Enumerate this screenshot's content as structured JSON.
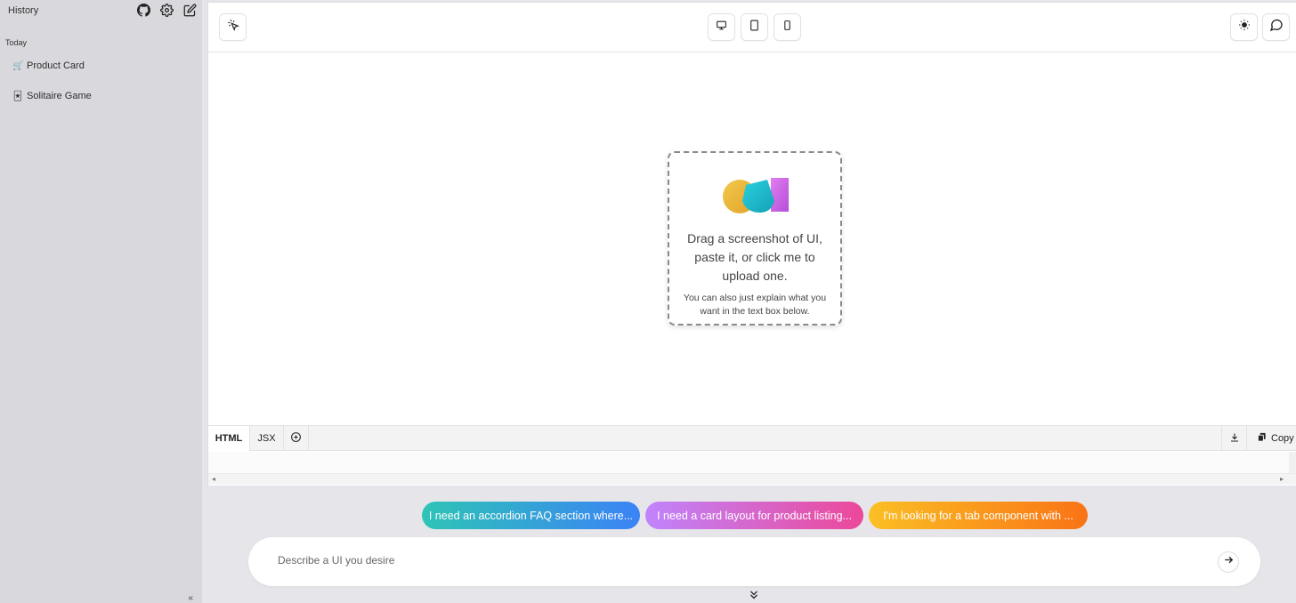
{
  "sidebar": {
    "title": "History",
    "section": "Today",
    "items": [
      {
        "emoji": "🛒",
        "label": "Product Card"
      },
      {
        "emoji": "🃏",
        "label": "Solitaire Game"
      }
    ],
    "icons": [
      "github-icon",
      "gear-icon",
      "edit-icon"
    ]
  },
  "toolbar": {
    "left": [
      "select-element-icon"
    ],
    "devices": [
      "desktop-icon",
      "tablet-icon",
      "mobile-icon"
    ],
    "right": [
      "sun-icon",
      "chat-icon"
    ]
  },
  "dropzone": {
    "main_text": "Drag a screenshot of UI, paste it, or click me to upload one.",
    "sub_text": "You can also just explain what you want in the text box below."
  },
  "code_tabs": [
    {
      "label": "HTML",
      "active": true
    },
    {
      "label": "JSX",
      "active": false
    }
  ],
  "code_actions": {
    "copy_label": "Copy"
  },
  "suggestions": [
    "I need an accordion FAQ section where...",
    "I need a card layout for product listing...",
    "I'm looking for a tab component with ..."
  ],
  "prompt": {
    "placeholder": "Describe a UI you desire"
  },
  "colors": {
    "sidebar_bg": "#d9d8dd",
    "chip1": [
      "#2ec4b6",
      "#3b82f6"
    ],
    "chip2": [
      "#c084fc",
      "#ec4899"
    ],
    "chip3": [
      "#fbbf24",
      "#f97316"
    ]
  }
}
